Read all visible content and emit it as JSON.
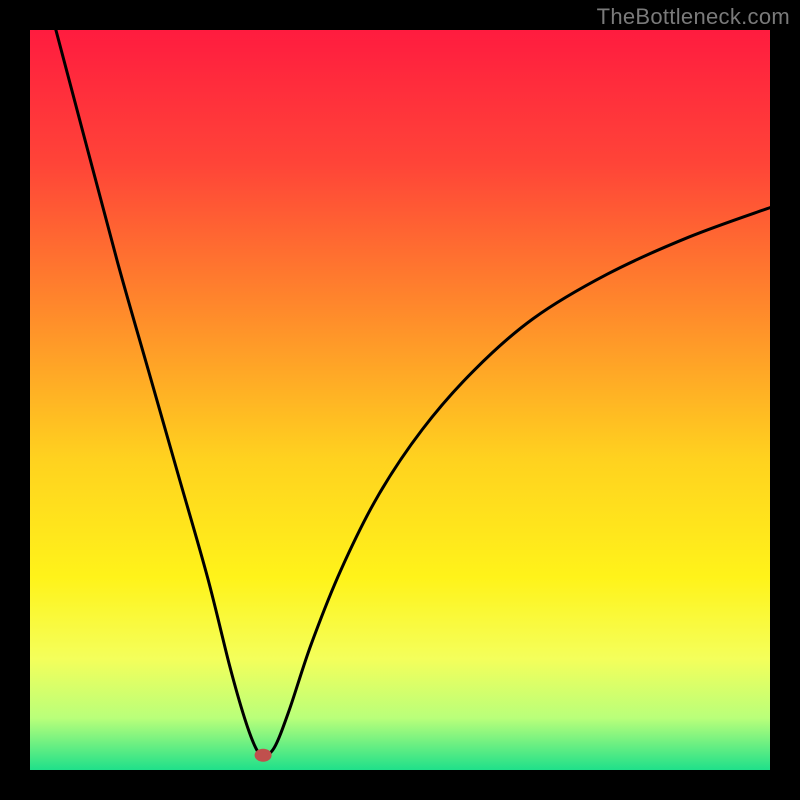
{
  "watermark": "TheBottleneck.com",
  "chart_data": {
    "type": "line",
    "title": "",
    "xlabel": "",
    "ylabel": "",
    "xlim": [
      0,
      100
    ],
    "ylim": [
      0,
      100
    ],
    "series": [
      {
        "name": "curve",
        "x": [
          3.5,
          8,
          12,
          16,
          20,
          24,
          27,
          29,
          30.5,
          31.5,
          33,
          35,
          38,
          42,
          47,
          53,
          60,
          68,
          78,
          89,
          100
        ],
        "y": [
          100,
          83,
          68,
          54,
          40,
          26,
          14,
          7,
          3,
          2,
          3,
          8,
          17,
          27,
          37,
          46,
          54,
          61,
          67,
          72,
          76
        ]
      }
    ],
    "marker": {
      "x": 31.5,
      "y": 2
    },
    "gradient_stops": [
      {
        "offset": 0,
        "color": "#ff1c3f"
      },
      {
        "offset": 18,
        "color": "#ff4438"
      },
      {
        "offset": 38,
        "color": "#ff8a2b"
      },
      {
        "offset": 58,
        "color": "#ffd21f"
      },
      {
        "offset": 74,
        "color": "#fff31a"
      },
      {
        "offset": 85,
        "color": "#f4ff5b"
      },
      {
        "offset": 93,
        "color": "#b9ff7a"
      },
      {
        "offset": 100,
        "color": "#1fe08a"
      }
    ]
  }
}
